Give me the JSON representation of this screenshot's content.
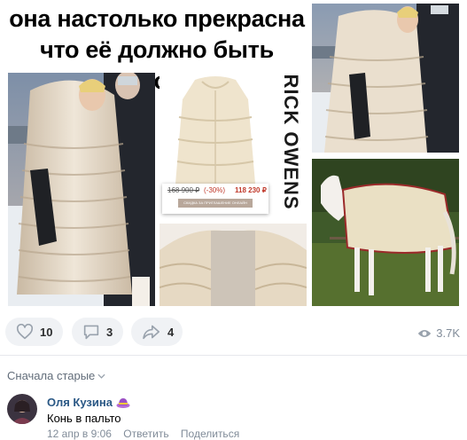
{
  "post": {
    "caption_line1": "она настолько прекрасна",
    "caption_line2": "что её должно быть много",
    "brand": "RICK OWENS",
    "price_old": "168 900 ₽",
    "price_discount": "(-30%)",
    "price_new": "118 230 ₽",
    "price_button": "СКИДКА ЗА ПРИГЛАШЕНИЕ ОНЛАЙН"
  },
  "actions": {
    "likes": "10",
    "comments": "3",
    "shares": "4",
    "views": "3.7K"
  },
  "comments_section": {
    "sort_label": "Сначала старые"
  },
  "comment": {
    "author": "Оля Кузина",
    "text": "Конь в пальто",
    "date": "12 апр в 9:06",
    "reply": "Ответить",
    "share": "Поделиться"
  },
  "colors": {
    "link": "#2a5885",
    "secondary_text": "#818c99",
    "pill_bg": "#f0f2f5",
    "icon": "#99a2ad"
  }
}
